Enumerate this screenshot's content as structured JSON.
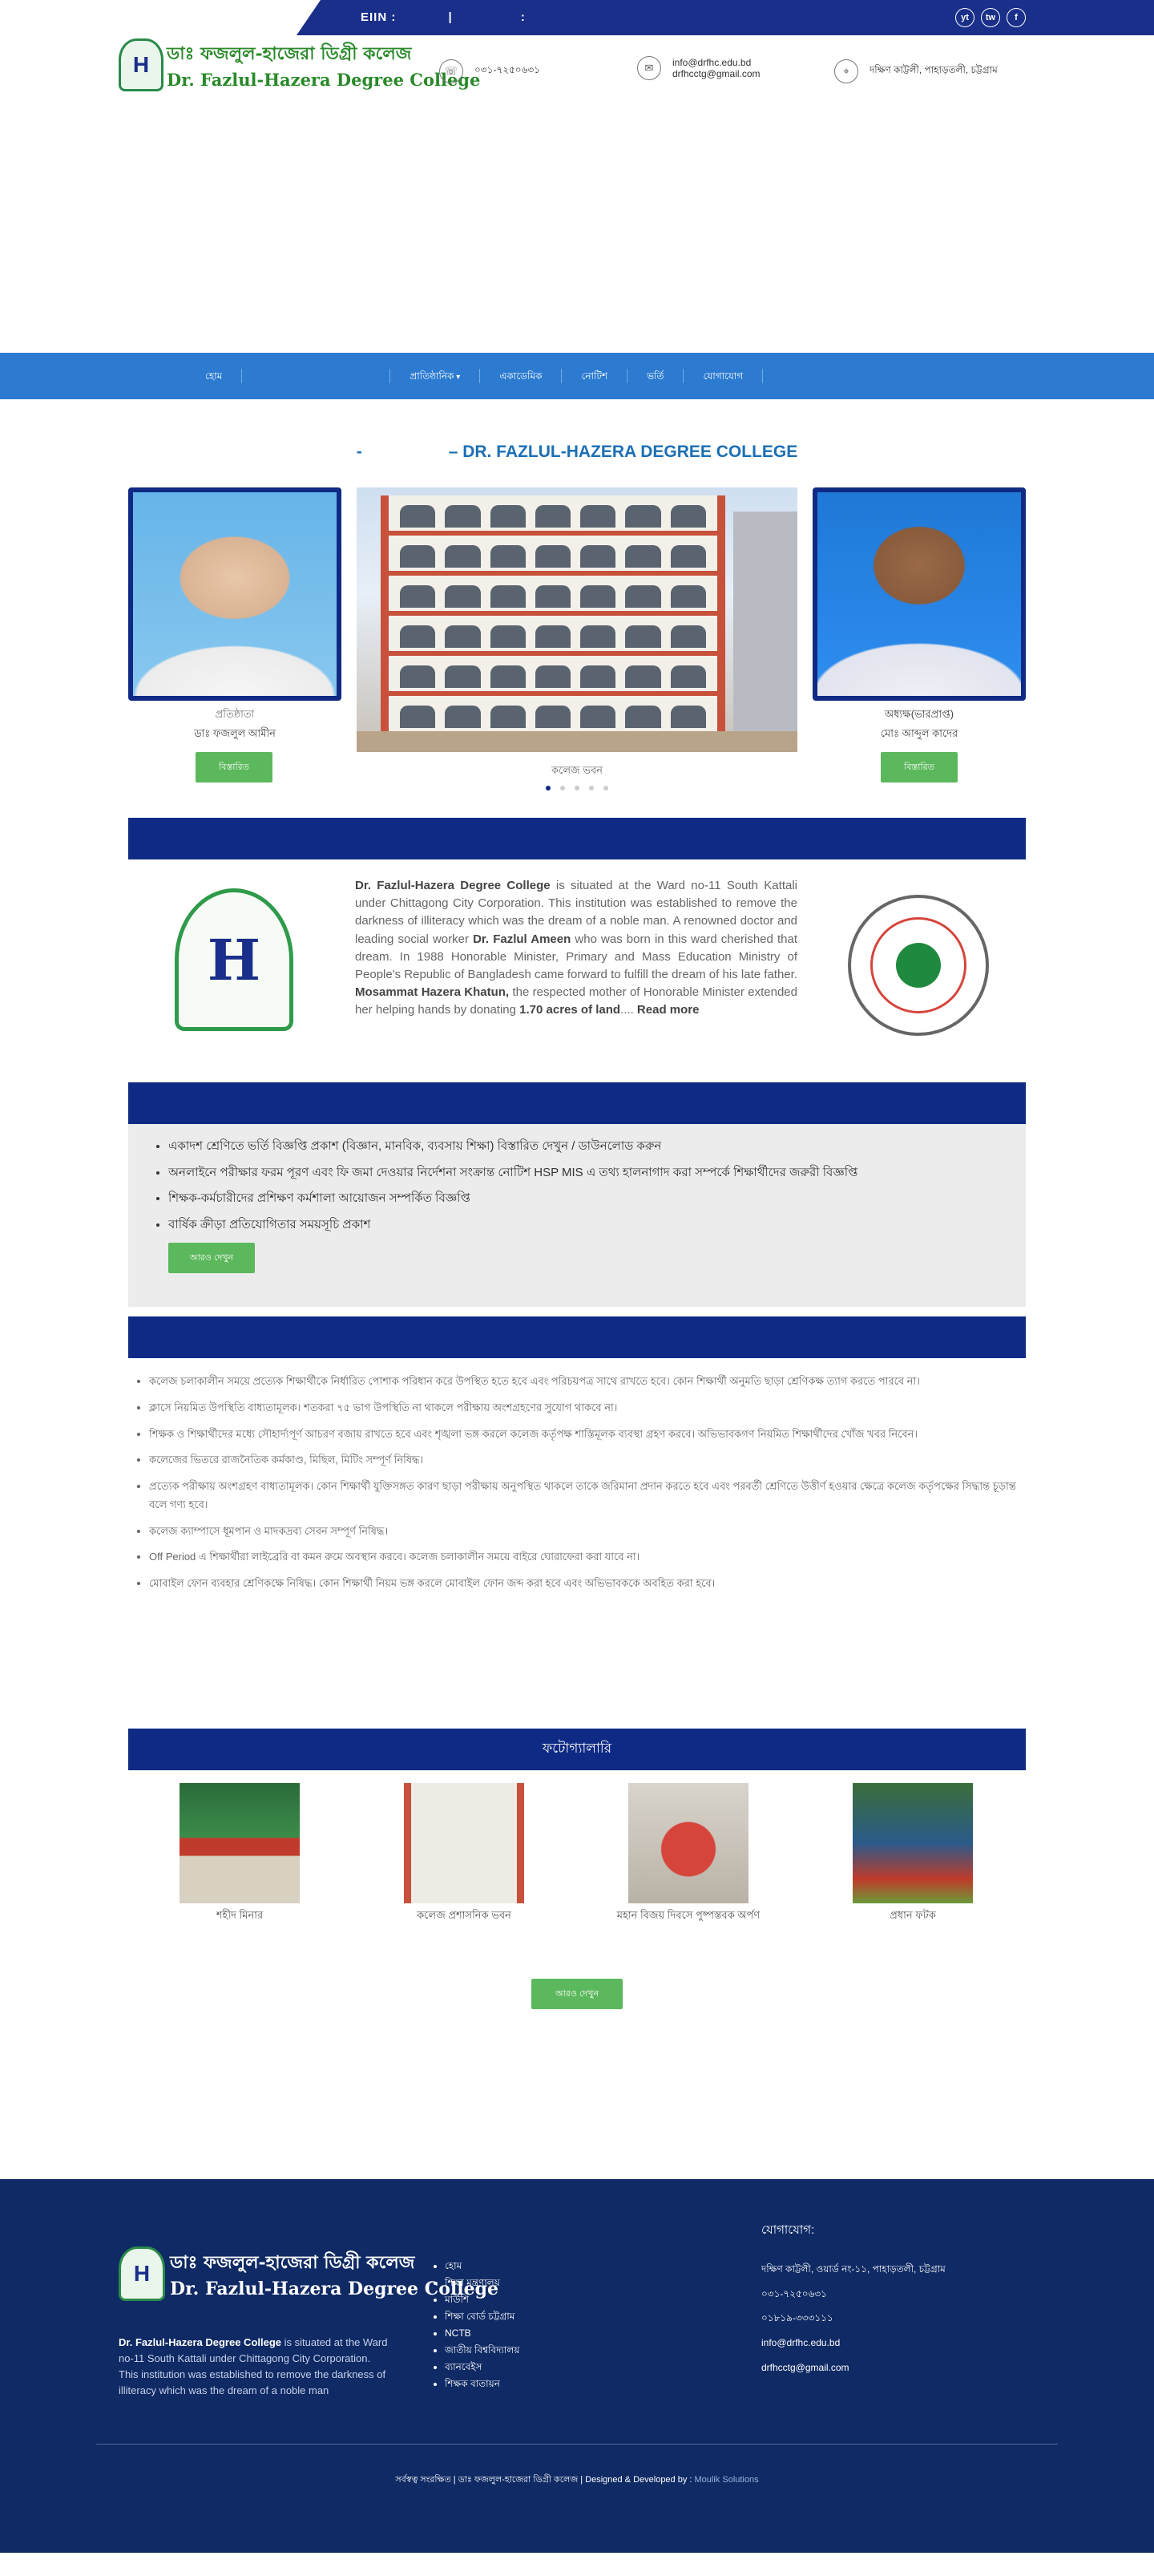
{
  "topbar": {
    "eiin_label": "EIIN :",
    "eiin_sep1": "|",
    "eiin_sep2": ":",
    "social": [
      "yt",
      "tw",
      "f"
    ]
  },
  "header": {
    "logo_bn": "ডাঃ ফজলুল-হাজেরা ডিগ্রী কলেজ",
    "logo_en": "Dr. Fazlul-Hazera Degree College",
    "logo_mark": "H",
    "phone": "০৩১-৭২৫০৬৩১",
    "email1": "info@drfhc.edu.bd",
    "email2": "drfhcctg@gmail.com",
    "address": "দক্ষিণ কাট্টলী, পাহাড়তলী, চট্টগ্রাম"
  },
  "nav": {
    "items": [
      "হোম",
      "",
      "প্রাতিষ্ঠানিক",
      "একাডেমিক",
      "নোটিশ",
      "ভর্তি",
      "যোগাযোগ"
    ]
  },
  "section_title": {
    "dash": "-",
    "text": "– DR. FAZLUL-HAZERA DEGREE COLLEGE"
  },
  "left_person": {
    "role": "প্রতিষ্ঠাতা",
    "name": "ডাঃ ফজলুল আমীন",
    "button": "বিস্তারিত"
  },
  "slider": {
    "caption": "কলেজ ভবন",
    "dots": 5,
    "active": 0
  },
  "right_person": {
    "role": "অধ্যক্ষ(ভারপ্রাপ্ত)",
    "name": "মোঃ আব্দুল কাদের",
    "button": "বিস্তারিত"
  },
  "about": {
    "p1_bold": "Dr. Fazlul-Hazera Degree College",
    "p1": " is situated at the Ward no-11 South Kattali under Chittagong City Corporation. This institution was established to remove the darkness of illiteracy which was the dream of a noble man. A renowned doctor and leading social worker ",
    "p2_bold": "Dr. Fazlul Ameen",
    "p2": " who was born in this ward cherished that dream. In 1988 Honorable Minister, Primary and Mass Education Ministry of People's Republic of Bangladesh came forward to fulfill the dream of his late father. ",
    "p3_bold": "Mosammat Hazera Khatun,",
    "p3": " the respected mother of Honorable Minister extended her helping hands by donating ",
    "p4_bold": "1.70 acres of land",
    "p4": ".... ",
    "read_more": "Read more",
    "seal_mark": "H"
  },
  "notices": {
    "items": [
      "একাদশ শ্রেণিতে ভর্তি বিজ্ঞপ্তি প্রকাশ (বিজ্ঞান, মানবিক, ব্যবসায় শিক্ষা) বিস্তারিত দেখুন / ডাউনলোড করুন",
      "অনলাইনে পরীক্ষার ফরম পূরণ এবং ফি জমা দেওয়ার নির্দেশনা সংক্রান্ত নোটিশ HSP MIS এ তথ্য হালনাগাদ করা সম্পর্কে শিক্ষার্থীদের জরুরী বিজ্ঞপ্তি",
      "শিক্ষক-কর্মচারীদের প্রশিক্ষণ কর্মশালা আয়োজন সম্পর্কিত বিজ্ঞপ্তি",
      "বার্ষিক ক্রীড়া প্রতিযোগিতার সময়সূচি প্রকাশ"
    ],
    "button": "আরও দেখুন"
  },
  "rules": {
    "items": [
      "কলেজ চলাকালীন সময়ে প্রত্যেক শিক্ষার্থীকে নির্ধারিত পোশাক পরিধান করে উপস্থিত হতে হবে এবং পরিচয়পত্র সাথে রাখতে হবে। কোন শিক্ষার্থী অনুমতি ছাড়া শ্রেণিকক্ষ ত্যাগ করতে পারবে না।",
      "ক্লাসে নিয়মিত উপস্থিতি বাধ্যতামূলক। শতকরা ৭৫ ভাগ উপস্থিতি না থাকলে পরীক্ষায় অংশগ্রহণের সুযোগ থাকবে না।",
      "শিক্ষক ও শিক্ষার্থীদের মধ্যে সৌহার্দ্যপূর্ণ আচরণ বজায় রাখতে হবে এবং শৃঙ্খলা ভঙ্গ করলে কলেজ কর্তৃপক্ষ শাস্তিমূলক ব্যবস্থা গ্রহণ করবে। অভিভাবকগণ নিয়মিত শিক্ষার্থীদের খোঁজ খবর নিবেন।",
      "কলেজের ভিতরে রাজনৈতিক কর্মকাণ্ড, মিছিল, মিটিং সম্পূর্ণ নিষিদ্ধ।",
      "প্রত্যেক পরীক্ষায় অংশগ্রহণ বাধ্যতামূলক। কোন শিক্ষার্থী যুক্তিসঙ্গত কারণ ছাড়া পরীক্ষায় অনুপস্থিত থাকলে তাকে জরিমানা প্রদান করতে হবে এবং পরবর্তী শ্রেণিতে উত্তীর্ণ হওয়ার ক্ষেত্রে কলেজ কর্তৃপক্ষের সিদ্ধান্ত চূড়ান্ত বলে গণ্য হবে।",
      "কলেজ ক্যাম্পাসে ধূমপান ও মাদকদ্রব্য সেবন সম্পূর্ণ নিষিদ্ধ।",
      "Off Period এ শিক্ষার্থীরা লাইব্রেরি বা কমন রুমে অবস্থান করবে। কলেজ চলাকালীন সময়ে বাইরে ঘোরাফেরা করা যাবে না।",
      "মোবাইল ফোন ব্যবহার শ্রেণিকক্ষে নিষিদ্ধ। কোন শিক্ষার্থী নিয়ম ভঙ্গ করলে মোবাইল ফোন জব্দ করা হবে এবং অভিভাবককে অবহিত করা হবে।"
    ]
  },
  "photos": {
    "header": "ফটোগ্যালারি",
    "items": [
      "শহীদ মিনার",
      "কলেজ প্রশাসনিক ভবন",
      "মহান বিজয় দিবসে পুষ্পস্তবক অর্পণ",
      "প্রধান ফটক"
    ],
    "button": "আরও দেখুন"
  },
  "footer": {
    "logo_bn": "ডাঃ ফজলুল-হাজেরা ডিগ্রী কলেজ",
    "logo_en": "Dr. Fazlul-Hazera Degree College",
    "logo_mark": "H",
    "about_bold": "Dr. Fazlul-Hazera Degree College",
    "about": " is situated at the Ward no-11 South Kattali under Chittagong City Corporation. This institution was established to remove the darkness of illiteracy which was the dream of a noble man",
    "links": [
      "হোম",
      "শিক্ষা মন্ত্রণালয়",
      "মাউশি",
      "শিক্ষা বোর্ড চট্টগ্রাম",
      "NCTB",
      "জাতীয় বিশ্ববিদ্যালয়",
      "ব্যানবেইস",
      "শিক্ষক বাতায়ন"
    ],
    "contact_heading": "যোগাযোগ:",
    "contact": [
      "দক্ষিণ কাট্টলী, ওয়ার্ড নং-১১, পাহাড়তলী, চট্টগ্রাম",
      "০৩১-৭২৫০৬৩১",
      "০১৮১৯-৩৩৩১১১",
      "info@drfhc.edu.bd",
      "drfhcctg@gmail.com"
    ],
    "copyright": "সর্বস্বত্ব সংরক্ষিত | ডাঃ ফজলুল-হাজেরা ডিগ্রী কলেজ | Designed & Developed by : ",
    "developer": "Moulik Solutions"
  }
}
